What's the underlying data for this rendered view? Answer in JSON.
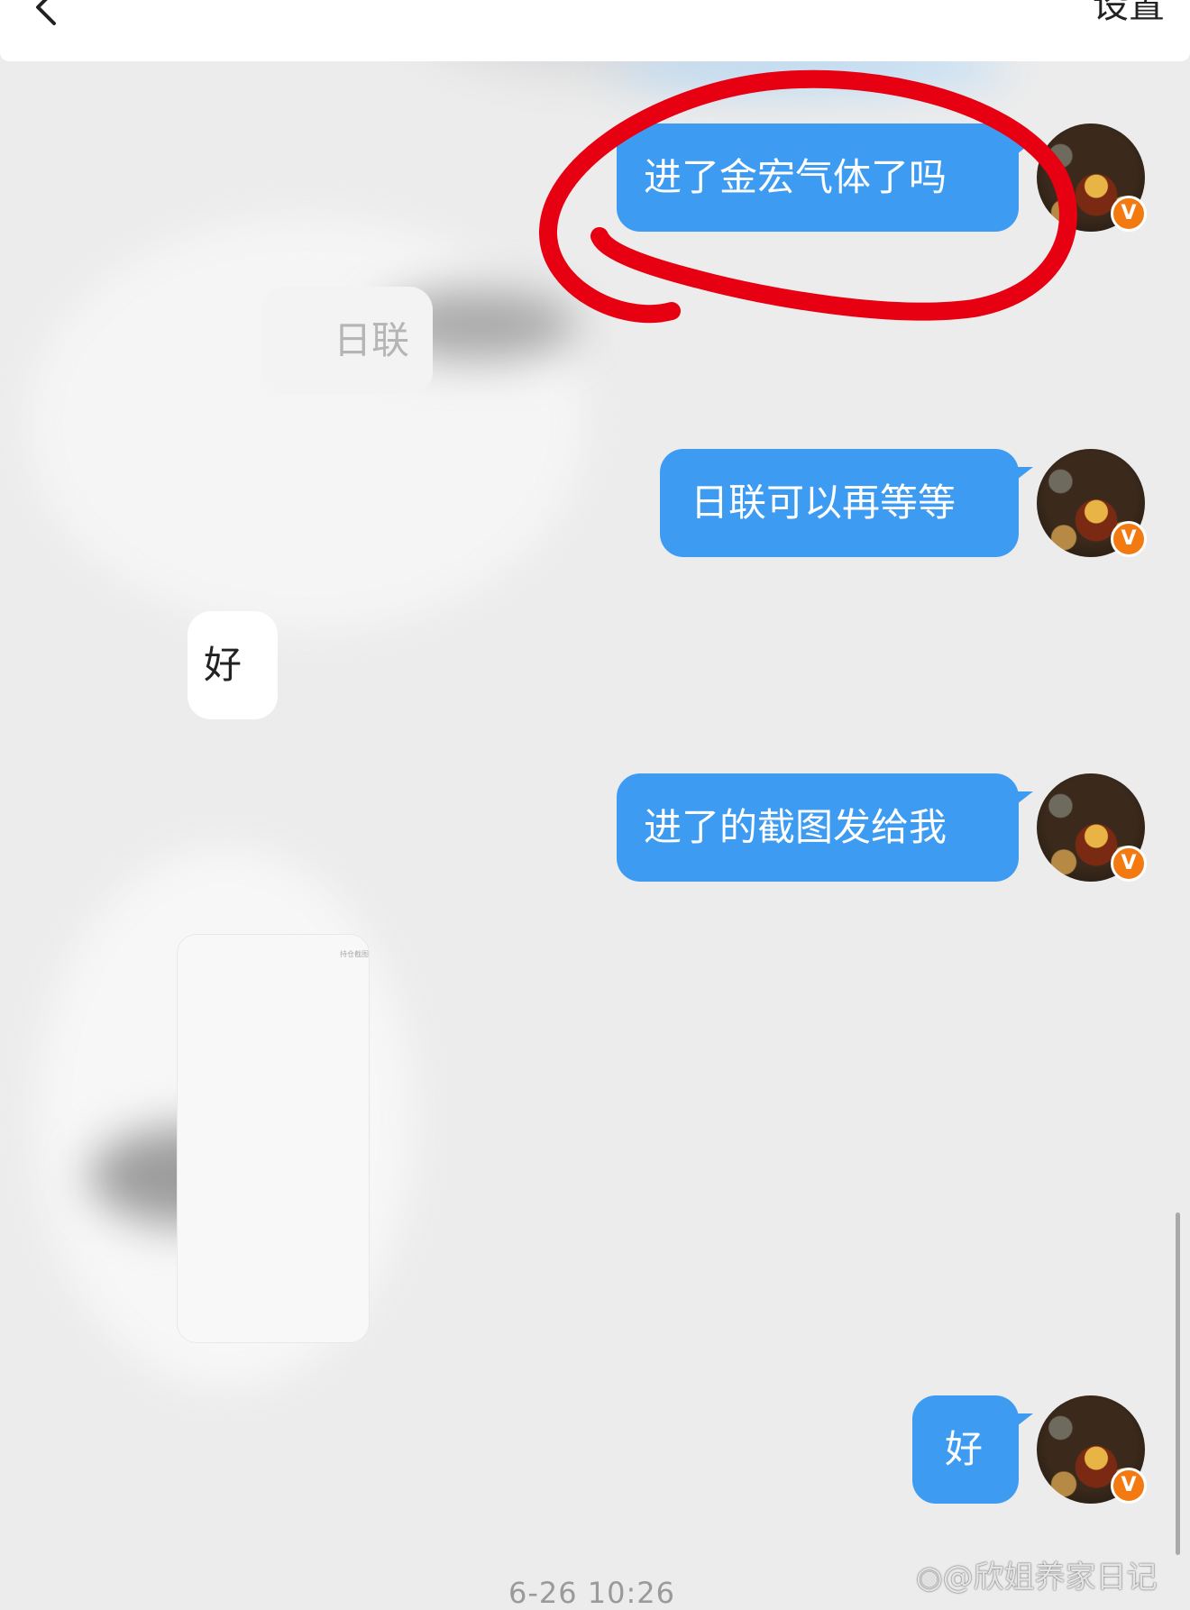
{
  "header": {
    "back_icon": "chevron-left-icon",
    "settings_label": "设置"
  },
  "messages": [
    {
      "side": "mine",
      "text": "进了金宏气体了吗"
    },
    {
      "side": "theirs",
      "text": "日联"
    },
    {
      "side": "mine",
      "text": "日联可以再等等"
    },
    {
      "side": "theirs",
      "text": "好"
    },
    {
      "side": "mine",
      "text": "进了的截图发给我"
    },
    {
      "side": "theirs",
      "text": "持仓截图"
    },
    {
      "side": "mine",
      "text": "好"
    }
  ],
  "avatar_badge": "V",
  "timestamp": "6-26 10:26",
  "watermark": "@欣姐养家日记",
  "colors": {
    "bubble_mine": "#3d9cf2",
    "annotation_circle": "#e60012",
    "verified_badge": "#f27a11"
  }
}
